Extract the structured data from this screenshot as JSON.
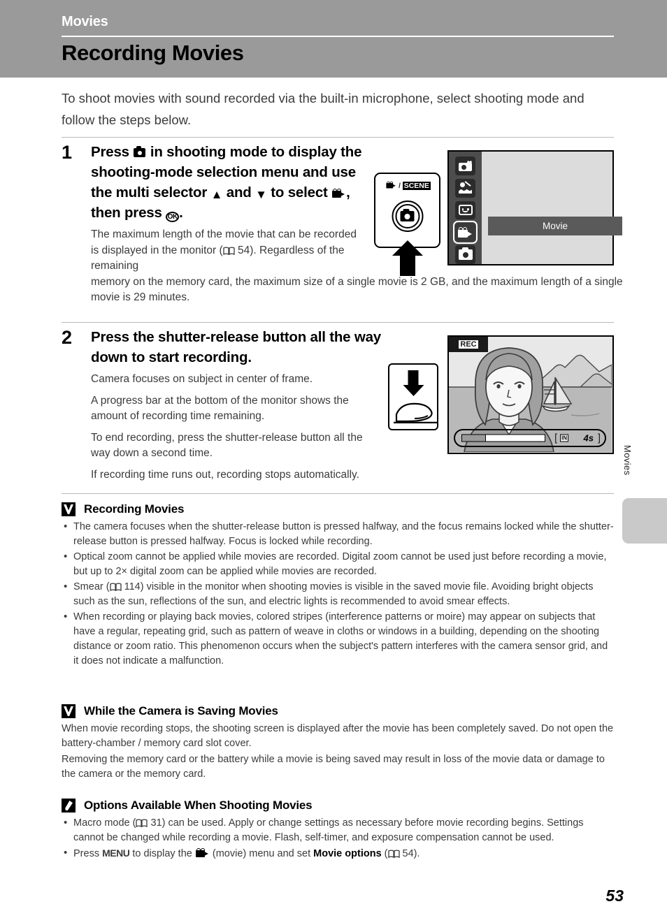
{
  "header": {
    "chapter": "Movies",
    "title": "Recording Movies"
  },
  "intro": "To shoot movies with sound recorded via the built-in microphone, select shooting mode and follow the steps below.",
  "steps": [
    {
      "number": "1",
      "head_p1": "Press",
      "head_p2": "in shooting mode to display the shooting-mode selection menu and use the multi selector",
      "head_p3": "and",
      "head_p4": "to select",
      "head_p5": ", then press",
      "head_p6": ".",
      "sub_line1": "The maximum length of the movie that can be recorded is displayed in the monitor",
      "sub_ref": "54",
      "sub_line2": "). Regardless of the remaining",
      "sub_line3": "memory on the memory card, the maximum size of a single movie is 2 GB, and the maximum length of a single movie is 29 minutes."
    },
    {
      "number": "2",
      "head": "Press the shutter-release button all the way down to start recording.",
      "sub": [
        "Camera focuses on subject in center of frame.",
        "A progress bar at the bottom of the monitor shows the amount of recording time remaining.",
        "To end recording, press the shutter-release button all the way down a second time.",
        "If recording time runs out, recording stops automatically."
      ]
    }
  ],
  "figure1": {
    "button_label_movie_icon": "movie-icon",
    "button_label_sep": "/",
    "button_label_scene": "SCENE",
    "shutter_icon": "camera-icon",
    "arrow": "arrow-up-icon",
    "mode_icons": [
      "pet-portrait-icon",
      "scene-mode-icon",
      "smart-portrait-icon",
      "movie-mode-icon",
      "auto-mode-icon"
    ],
    "selected_mode_index": 3,
    "selected_mode_label": "Movie"
  },
  "figure2": {
    "arrow": "arrow-down-icon",
    "finger": "finger-icon",
    "rec_badge": "REC",
    "memory_badge": "IN",
    "time_remaining": "4s",
    "bracket_left": "[",
    "bracket_right": "]",
    "progress_percent": 72
  },
  "side": {
    "tab_label": "Movies"
  },
  "notes": [
    {
      "badge": "caution-v-icon",
      "title": "Recording Movies",
      "items": [
        "The camera focuses when the shutter-release button is pressed halfway, and the focus remains locked while the shutter-release button is pressed halfway. Focus is locked while recording.",
        "Optical zoom cannot be applied while movies are recorded. Digital zoom cannot be used just before recording a movie, but up to 2× digital zoom can be applied while movies are recorded.",
        "Smear (",
        "114) visible in the monitor when shooting movies is visible in the saved movie file. Avoiding bright objects such as the sun, reflections of the sun, and electric lights is recommended to avoid smear effects.",
        "When recording or playing back movies, colored stripes (interference patterns or moire) may appear on subjects that have a regular, repeating grid, such as pattern of weave in cloths or windows in a building, depending on the shooting distance or zoom ratio. This phenomenon occurs when the subject's pattern interferes with the camera sensor grid, and it does not indicate a malfunction."
      ]
    },
    {
      "badge": "caution-v-icon",
      "title": "While the Camera is Saving Movies",
      "paragraphs": [
        "When movie recording stops, the shooting screen is displayed after the movie has been completely saved. Do not open the battery-chamber / memory card slot cover.",
        "Removing the memory card or the battery while a movie is being saved may result in loss of the movie data or damage to the camera or the memory card."
      ]
    },
    {
      "badge": "pencil-note-icon",
      "title": "Options Available When Shooting Movies",
      "item1_a": "Macro mode (",
      "item1_ref": "31",
      "item1_b": ") can be used. Apply or change settings as necessary before movie recording begins. Settings cannot be changed while recording a movie. Flash, self-timer, and exposure compensation cannot be used.",
      "item2_a": "Press",
      "item2_menu": "MENU",
      "item2_b": "to display the",
      "item2_c": "(movie) menu and set",
      "item2_bold": "Movie options",
      "item2_ref": "54",
      "item2_d": ")."
    }
  ],
  "page_number": "53"
}
